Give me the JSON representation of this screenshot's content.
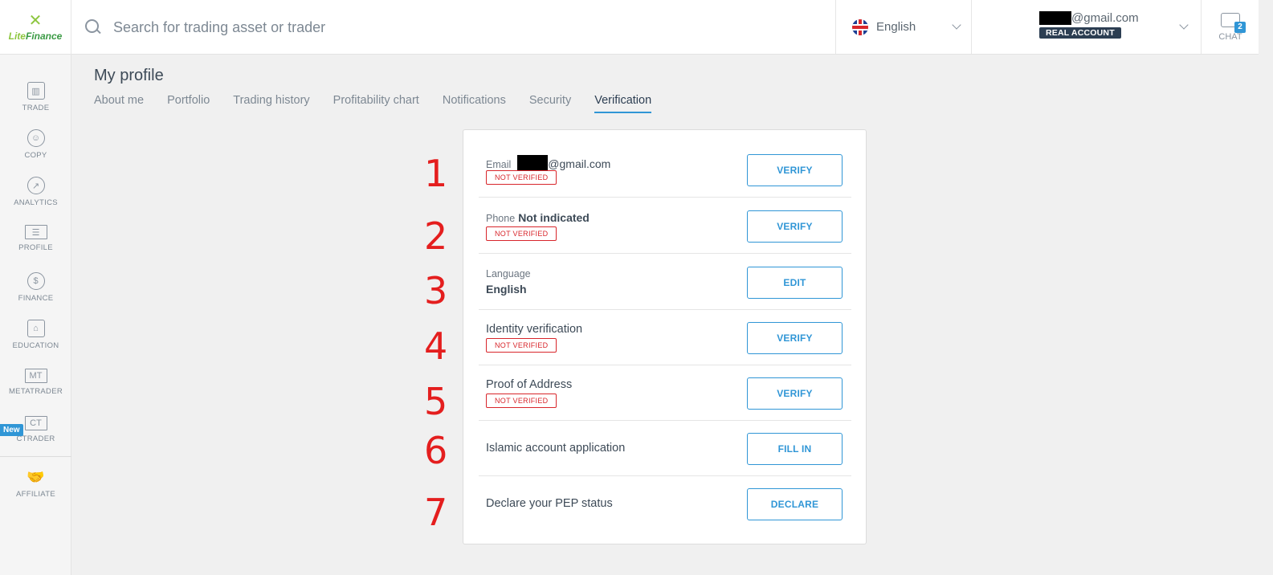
{
  "brand": {
    "logo_text_lite": "Lite",
    "logo_text_finance": "Finance"
  },
  "search": {
    "placeholder": "Search for trading asset or trader"
  },
  "language_selector": {
    "label": "English"
  },
  "account": {
    "email_suffix": "@gmail.com",
    "badge": "REAL ACCOUNT"
  },
  "chat": {
    "label": "CHAT",
    "count": "2"
  },
  "sidebar": {
    "items": [
      {
        "label": "TRADE",
        "icon": "chart-icon"
      },
      {
        "label": "COPY",
        "icon": "user-icon"
      },
      {
        "label": "ANALYTICS",
        "icon": "analytics-icon"
      },
      {
        "label": "PROFILE",
        "icon": "id-card-icon"
      },
      {
        "label": "FINANCE",
        "icon": "dollar-icon",
        "glyph": "$"
      },
      {
        "label": "EDUCATION",
        "icon": "graduation-cap-icon"
      },
      {
        "label": "METATRADER",
        "icon": "metatrader-icon",
        "glyph": "MT"
      },
      {
        "label": "CTRADER",
        "icon": "ctrader-icon",
        "glyph": "CT"
      },
      {
        "label": "AFFILIATE",
        "icon": "handshake-icon"
      }
    ],
    "new_badge": "New"
  },
  "page": {
    "title": "My profile",
    "tabs": [
      "About me",
      "Portfolio",
      "Trading history",
      "Profitability chart",
      "Notifications",
      "Security",
      "Verification"
    ],
    "active_tab": "Verification"
  },
  "verification": {
    "email": {
      "label": "Email",
      "value_suffix": "@gmail.com",
      "status": "NOT VERIFIED",
      "button": "VERIFY"
    },
    "phone": {
      "label": "Phone",
      "value": "Not indicated",
      "status": "NOT VERIFIED",
      "button": "VERIFY"
    },
    "language": {
      "label": "Language",
      "value": "English",
      "button": "EDIT"
    },
    "identity": {
      "label": "Identity verification",
      "status": "NOT VERIFIED",
      "button": "VERIFY"
    },
    "address": {
      "label": "Proof of Address",
      "status": "NOT VERIFIED",
      "button": "VERIFY"
    },
    "islamic": {
      "label": "Islamic account application",
      "button": "FILL IN"
    },
    "pep": {
      "label": "Declare your PEP status",
      "button": "DECLARE"
    }
  },
  "annotations": [
    "1",
    "2",
    "3",
    "4",
    "5",
    "6",
    "7"
  ],
  "colors": {
    "accent": "#3096d6",
    "status_red": "#d8262b",
    "annotation_red": "#e41e1e",
    "brand_green": "#8dc63f"
  }
}
